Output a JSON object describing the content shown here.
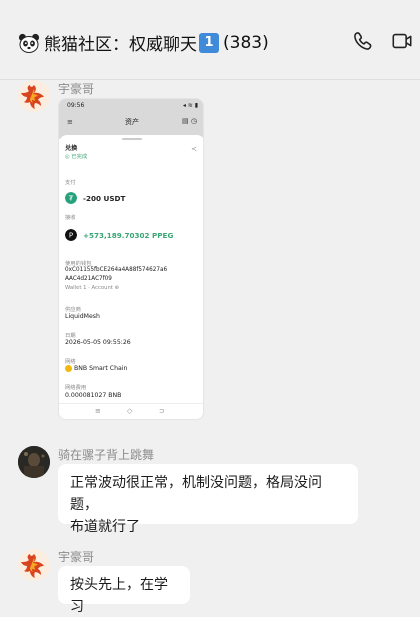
{
  "header": {
    "emoji_icon": "panda-face-icon",
    "title": "熊猫社区：权威聊天",
    "keycap": "1",
    "count": "(383)",
    "call_icon": "phone-icon",
    "video_icon": "video-camera-icon"
  },
  "messages": [
    {
      "sender": "宇豪哥",
      "avatar_icon": "phoenix-avatar",
      "type": "image",
      "screenshot": {
        "status_time": "09:56",
        "status_right": "◂ ≋ ▮",
        "app_title": "资产",
        "menu_icon": "≡",
        "right_icons": "▤ ◷",
        "action": "兑换",
        "action_status": "◎ 已完成",
        "share_icon": "≺",
        "pay_label": "支付",
        "pay_amount": "-200 USDT",
        "receive_label": "接收",
        "receive_amount": "+573,189.70302 PPEG",
        "contract_label": "使用的钱包",
        "contract_addr_1": "0xC01155fbCE264a4A88f574627a6",
        "contract_addr_2": "AAC4d21AC7f09",
        "wallet_name": "Wallet 1 · Account ⊛",
        "provider_label": "供应商",
        "provider": "LiquidMesh",
        "date_label": "日期",
        "date": "2026-05-05 09:55:26",
        "network_label": "网络",
        "network": "BNB Smart Chain",
        "fee_label": "网络费用",
        "fee": "0.000081027 BNB",
        "nav_left": "≡",
        "nav_mid": "◇",
        "nav_right": "⊃"
      }
    },
    {
      "sender": "骑在骡子背上跳舞",
      "avatar_icon": "dark-photo-avatar",
      "type": "text",
      "lines": [
        "正常波动很正常，机制没问题，格局没问题，",
        "布道就行了"
      ]
    },
    {
      "sender": "宇豪哥",
      "avatar_icon": "phoenix-avatar",
      "type": "text",
      "lines": [
        "按头先上，在学习"
      ]
    }
  ],
  "colors": {
    "background": "#f0f0f0",
    "bubble": "#ffffff",
    "sender_name": "#8c8c8c",
    "receive_green": "#3aa676",
    "keycap_blue": "#3f8bd9"
  }
}
